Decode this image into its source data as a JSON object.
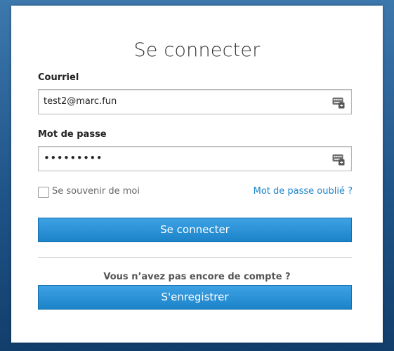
{
  "login": {
    "title": "Se connecter",
    "email_label": "Courriel",
    "email_value": "test2@marc.fun",
    "password_label": "Mot de passe",
    "password_value": "•••••••••",
    "remember_label": "Se souvenir de moi",
    "remember_checked": false,
    "forgot_link": "Mot de passe oublié ?",
    "submit_label": "Se connecter",
    "no_account_text": "Vous n’avez pas encore de compte ?",
    "register_label": "S'enregistrer"
  },
  "icons": {
    "field_icon": "keyboard-icon"
  },
  "colors": {
    "accent": "#1c83c9",
    "link": "#1a84c9",
    "background": "#1f5488"
  }
}
